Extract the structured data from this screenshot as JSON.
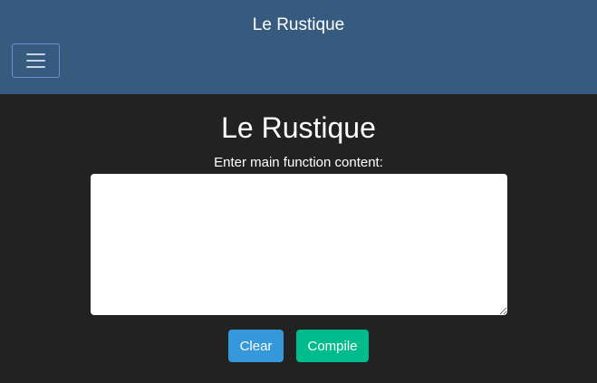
{
  "navbar": {
    "brand": "Le Rustique",
    "toggle_icon": "hamburger-menu-icon"
  },
  "main": {
    "title": "Le Rustique",
    "editor_label": "Enter main function content:",
    "editor_value": "",
    "editor_placeholder": ""
  },
  "actions": {
    "clear_label": "Clear",
    "compile_label": "Compile"
  },
  "colors": {
    "navbar_bg": "#375a7f",
    "page_bg": "#222222",
    "clear_button": "#3498db",
    "compile_button": "#00bc8c"
  }
}
